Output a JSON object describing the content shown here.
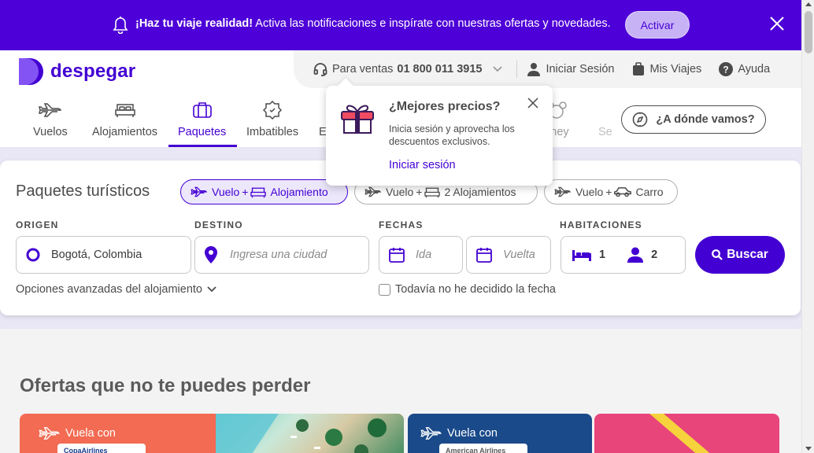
{
  "notification": {
    "bold": "¡Haz tu viaje realidad!",
    "text": " Activa las notificaciones e inspírate con nuestras ofertas y novedades.",
    "activate_label": "Activar"
  },
  "brand": {
    "name": "despegar",
    "color": "#4300d2"
  },
  "topbar": {
    "sales_label": "Para ventas",
    "sales_phone": "01 800 011 3915",
    "login_label": "Iniciar Sesión",
    "trips_label": "Mis Viajes",
    "help_label": "Ayuda"
  },
  "nav": {
    "items": [
      {
        "label": "Vuelos",
        "icon": "plane-icon"
      },
      {
        "label": "Alojamientos",
        "icon": "bed-icon"
      },
      {
        "label": "Paquetes",
        "icon": "suitcase-icon",
        "active": true
      },
      {
        "label": "Imbatibles",
        "icon": "badge-icon"
      },
      {
        "label": "E",
        "icon": ""
      },
      {
        "label": "sney",
        "icon": "mickey-icon"
      },
      {
        "label": "Se",
        "icon": ""
      }
    ],
    "where_label": "¿A dónde vamos?"
  },
  "popup": {
    "title": "¿Mejores precios?",
    "description": "Inicia sesión y aprovecha los descuentos exclusivos.",
    "link": "Iniciar sesión"
  },
  "search": {
    "title": "Paquetes turísticos",
    "chips": [
      {
        "flight": "Vuelo",
        "plus": "+",
        "stay": "Alojamiento",
        "selected": true
      },
      {
        "flight": "Vuelo",
        "plus": "+",
        "stay": "2 Alojamientos",
        "selected": false
      },
      {
        "flight": "Vuelo",
        "plus": "+",
        "stay": "Carro",
        "selected": false
      }
    ],
    "origin_label": "ORIGEN",
    "origin_value": "Bogotá, Colombia",
    "destination_label": "DESTINO",
    "destination_placeholder": "Ingresa una ciudad",
    "dates_label": "FECHAS",
    "departure_placeholder": "Ida",
    "return_placeholder": "Vuelta",
    "rooms_label": "HABITACIONES",
    "rooms_value": "1",
    "guests_value": "2",
    "search_label": "Buscar",
    "advanced_label": "Opciones avanzadas del alojamiento",
    "undecided_label": "Todavía no he decidido la fecha"
  },
  "offers": {
    "title": "Ofertas que no te puedes perder",
    "cards": [
      {
        "label": "Vuela con",
        "airline": "CopaAirlines",
        "color": "#f26b52"
      },
      {
        "label": "Vuela con",
        "airline": "American Airlines",
        "color": "#1a4a8a"
      },
      {
        "label": "",
        "airline": "",
        "color": "#e8457a"
      }
    ]
  }
}
